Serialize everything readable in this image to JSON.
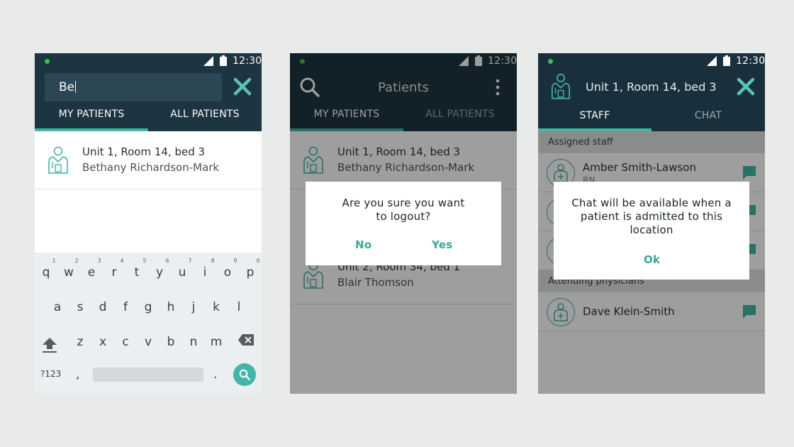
{
  "colors": {
    "appbar": "#1d3441",
    "accent": "#3fb7a3",
    "background": "#e9eaea"
  },
  "status": {
    "time": "12:30"
  },
  "screen1": {
    "search_value": "Be",
    "close_icon": "close-icon",
    "tabs": {
      "mine": "MY PATIENTS",
      "all": "ALL PATIENTS",
      "active": "mine"
    },
    "results": [
      {
        "location": "Unit 1, Room 14, bed 3",
        "name": "Bethany Richardson-Mark"
      }
    ],
    "keyboard": {
      "row1": [
        "q",
        "w",
        "e",
        "r",
        "t",
        "y",
        "u",
        "i",
        "o",
        "p"
      ],
      "row1_numbers": [
        "1",
        "2",
        "3",
        "4",
        "5",
        "6",
        "7",
        "8",
        "9",
        "0"
      ],
      "row2": [
        "a",
        "s",
        "d",
        "f",
        "g",
        "h",
        "j",
        "k",
        "l"
      ],
      "row3": [
        "z",
        "x",
        "c",
        "v",
        "b",
        "n",
        "m"
      ],
      "symbols": "?123",
      "comma": ",",
      "period": "."
    }
  },
  "screen2": {
    "title": "Patients",
    "tabs": {
      "mine": "MY PATIENTS",
      "all": "ALL PATIENTS",
      "active": "mine"
    },
    "patients": [
      {
        "location": "Unit 1, Room 14, bed 3",
        "name": "Bethany Richardson-Mark"
      },
      {
        "location": "Unit 2, Room 34, bed 1",
        "name": "Blair Thomson"
      }
    ],
    "dialog": {
      "message": "Are you sure you want to logout?",
      "no": "No",
      "yes": "Yes"
    }
  },
  "screen3": {
    "title": "Unit 1, Room 14, bed 3",
    "tabs": {
      "staff": "STAFF",
      "chat": "CHAT",
      "active": "staff"
    },
    "assigned_label": "Assigned staff",
    "assigned": [
      {
        "name": "Amber Smith-Lawson",
        "role": "RN"
      }
    ],
    "attending_label": "Attending physicians",
    "attending": [
      {
        "name": "Dave Klein-Smith"
      }
    ],
    "dialog": {
      "message": "Chat will be available when a patient is admitted to this location",
      "ok": "Ok"
    }
  }
}
